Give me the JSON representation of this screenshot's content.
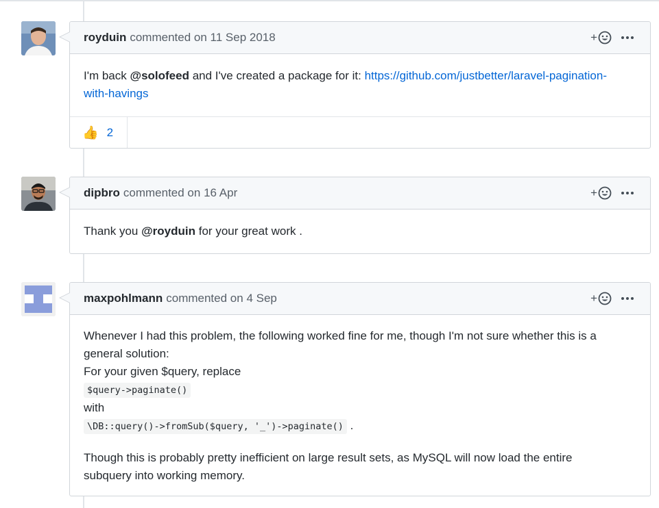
{
  "comments": [
    {
      "author": "royduin",
      "verb": "commented on",
      "date": "11 Sep 2018",
      "body": {
        "prefix": "I'm back ",
        "mention": "@solofeed",
        "middle": " and I've created a package for it: ",
        "link_line1": "https://github.com/justbetter/laravel-pagination-",
        "link_line2": "with-havings"
      },
      "reaction": {
        "emoji": "👍",
        "count": "2"
      }
    },
    {
      "author": "dipbro",
      "verb": "commented on",
      "date": "16 Apr",
      "body": {
        "prefix": "Thank you ",
        "mention": "@royduin",
        "suffix": " for your great work ."
      }
    },
    {
      "author": "maxpohlmann",
      "verb": "commented on",
      "date": "4 Sep",
      "body": {
        "line1": "Whenever I had this problem, the following worked fine for me, though I'm not sure whether this is a",
        "line2": "general solution:",
        "line3": "For your given $query, replace",
        "code1": "$query->paginate()",
        "line4": "with",
        "code2": "\\DB::query()->fromSub($query, '_')->paginate()",
        "code2_suffix": ".",
        "para2_line1": "Though this is probably pretty inefficient on large result sets, as MySQL will now load the entire",
        "para2_line2": "subquery into working memory."
      }
    }
  ],
  "actions": {
    "reaction_plus": "+"
  },
  "icons": {
    "add_reaction": "smiley-icon",
    "more": "kebab-horizontal-icon"
  }
}
